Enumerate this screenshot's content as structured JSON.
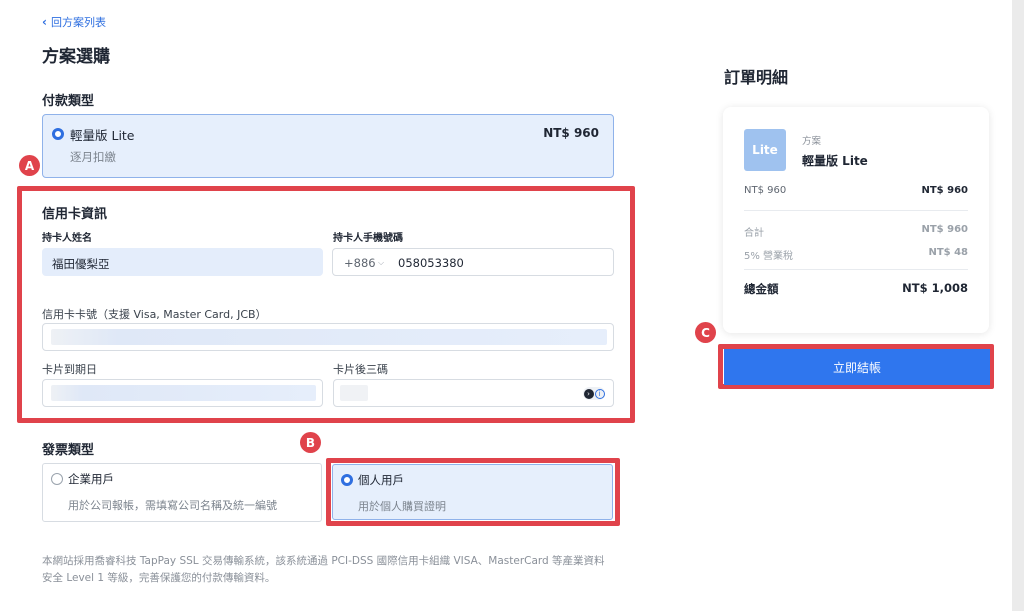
{
  "header": {
    "back_label": "回方案列表",
    "page_title": "方案選購"
  },
  "payment": {
    "section_title": "付款類型",
    "plan_name": "輕量版 Lite",
    "plan_cycle": "逐月扣繳",
    "plan_price": "NT$ 960"
  },
  "card": {
    "section_title": "信用卡資訊",
    "holder_name_label": "持卡人姓名",
    "holder_name_value": "福田優梨亞",
    "holder_phone_label": "持卡人手機號碼",
    "country_code": "+886",
    "phone_value": "058053380",
    "card_number_label": "信用卡卡號（支援 Visa, Master Card, JCB）",
    "expiry_label": "卡片到期日",
    "cvc_label": "卡片後三碼"
  },
  "invoice": {
    "section_title": "發票類型",
    "options": [
      {
        "title": "企業用戶",
        "desc": "用於公司報帳，需填寫公司名稱及統一編號",
        "selected": false
      },
      {
        "title": "個人用戶",
        "desc": "用於個人購買證明",
        "selected": true
      }
    ]
  },
  "footnote": "本網站採用喬睿科技 TapPay SSL 交易傳輸系統，該系統通過 PCI-DSS 國際信用卡組織 VISA、MasterCard 等產業資料安全 Level 1 等級，完善保護您的付款傳輸資料。",
  "order": {
    "title": "訂單明細",
    "logo_text": "Lite",
    "plan_label": "方案",
    "plan_name": "輕量版 Lite",
    "line_item_label": "NT$ 960",
    "line_item_value": "NT$ 960",
    "subtotal_label": "合計",
    "subtotal_value": "NT$ 960",
    "tax_label": "5% 營業稅",
    "tax_value": "NT$ 48",
    "total_label": "總金額",
    "total_value": "NT$ 1,008",
    "checkout_label": "立即結帳"
  },
  "annotations": {
    "a": "A",
    "b": "B",
    "c": "C"
  },
  "colors": {
    "accent": "#2f76ee",
    "annotation_red": "#e0434b",
    "selected_bg": "#e6effc"
  }
}
